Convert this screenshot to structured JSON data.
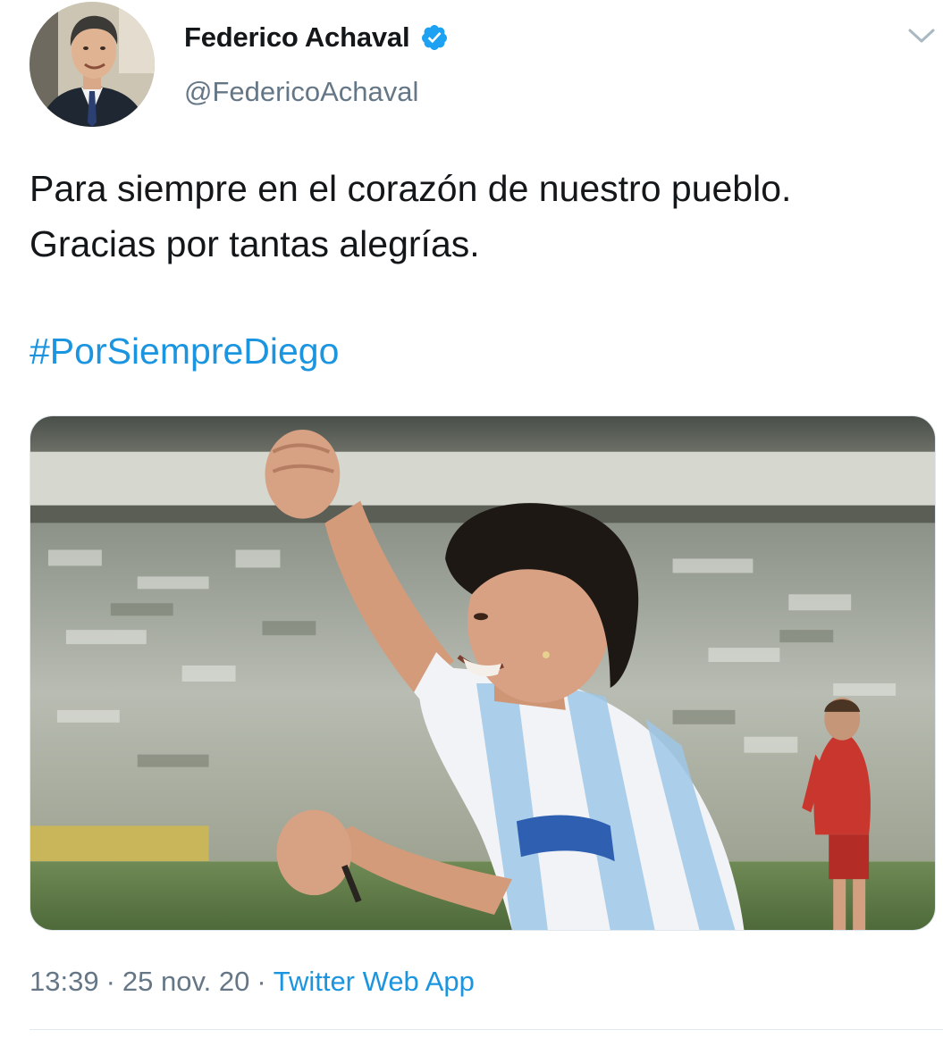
{
  "author": {
    "display_name": "Federico Achaval",
    "handle": "@FedericoAchaval",
    "verified": true,
    "verified_icon": "verified-badge-icon",
    "avatar_icon": "avatar"
  },
  "menu": {
    "caret_icon": "chevron-down-icon"
  },
  "tweet": {
    "text_lines": [
      "Para siempre en el corazón de nuestro pueblo.",
      "Gracias por tantas alegrías."
    ],
    "hashtag": "#PorSiempreDiego"
  },
  "media": {
    "type": "photo"
  },
  "meta": {
    "time": "13:39",
    "date": "25 nov. 20",
    "separator": "·",
    "source": "Twitter Web App"
  },
  "colors": {
    "link": "#1b95e0",
    "secondary": "#657786",
    "text": "#14171a",
    "border": "#e1e8ed"
  }
}
